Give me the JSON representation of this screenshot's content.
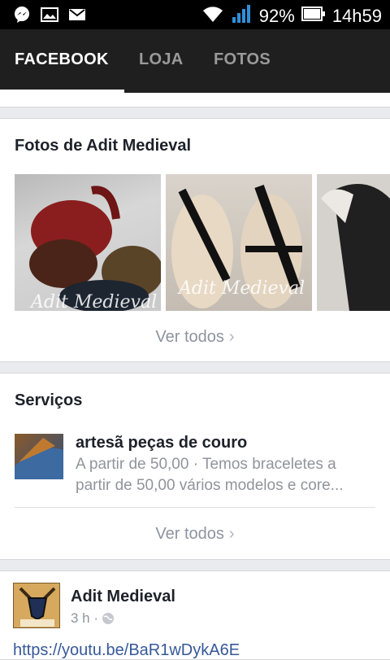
{
  "status_bar": {
    "battery": "92%",
    "time": "14h59",
    "icons": [
      "messenger-icon",
      "gallery-icon",
      "gmail-icon",
      "wifi-icon",
      "signal-icon",
      "battery-icon"
    ]
  },
  "tabs": [
    {
      "label": "FACEBOOK",
      "active": true
    },
    {
      "label": "LOJA",
      "active": false
    },
    {
      "label": "FOTOS",
      "active": false
    }
  ],
  "photos_section": {
    "title": "Fotos de Adit Medieval",
    "watermark": "Adit Medieval",
    "see_all": "Ver todos"
  },
  "services_section": {
    "title": "Serviços",
    "item": {
      "title": "artesã peças de couro",
      "description_line1": "A partir de 50,00 · Temos braceletes a",
      "description_line2": "partir de 50,00 vários modelos e core..."
    },
    "see_all": "Ver todos"
  },
  "post": {
    "author": "Adit Medieval",
    "time": "3 h ·",
    "link": "https://youtu.be/BaR1wDykA6E"
  },
  "colors": {
    "app_bar": "#1f1f1f",
    "background": "#e9ebee",
    "link": "#365899"
  }
}
